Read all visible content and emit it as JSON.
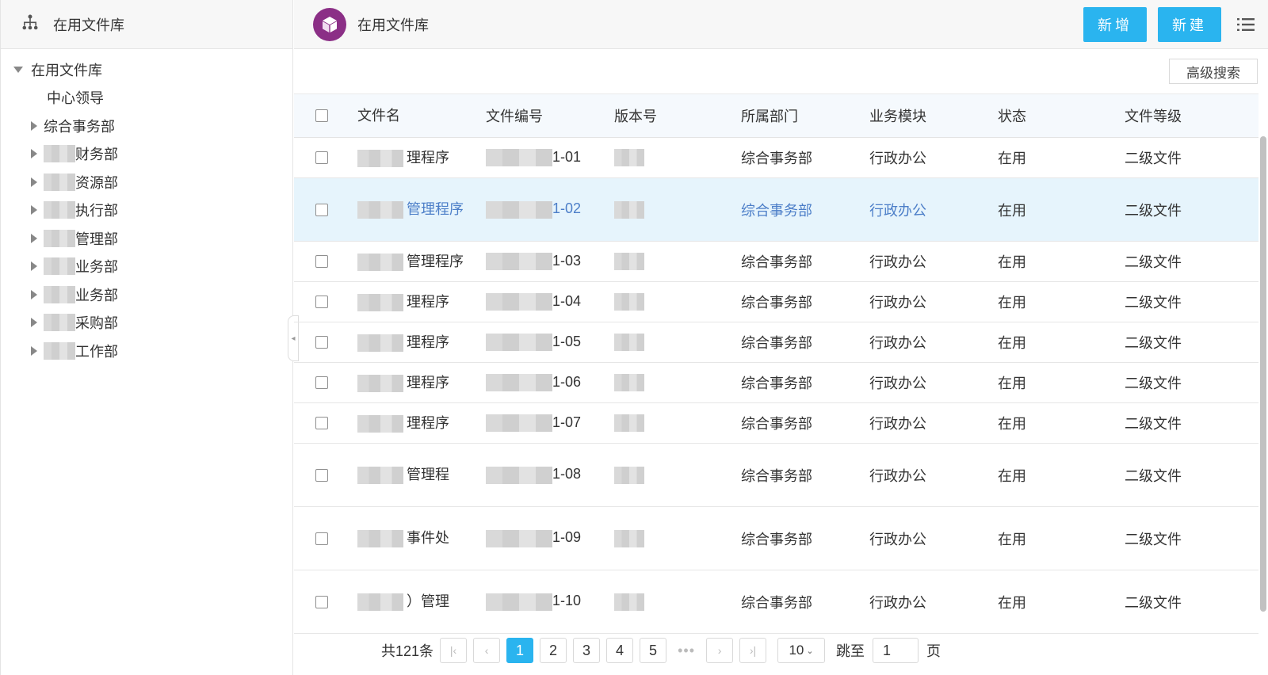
{
  "sidebar": {
    "title": "在用文件库",
    "tree_root": "在用文件库",
    "items": [
      {
        "label": "中心领导",
        "expandable": false,
        "blur_w": 0
      },
      {
        "label": "综合事务部",
        "expandable": true,
        "blur_w": 0
      },
      {
        "label": "财务部",
        "expandable": true,
        "blur_w": 40
      },
      {
        "label": "资源部",
        "expandable": true,
        "blur_w": 40
      },
      {
        "label": "执行部",
        "expandable": true,
        "blur_w": 40
      },
      {
        "label": "管理部",
        "expandable": true,
        "blur_w": 40
      },
      {
        "label": "业务部",
        "expandable": true,
        "blur_w": 40
      },
      {
        "label": "业务部",
        "expandable": true,
        "blur_w": 40
      },
      {
        "label": "采购部",
        "expandable": true,
        "blur_w": 40
      },
      {
        "label": "工作部",
        "expandable": true,
        "blur_w": 40
      }
    ]
  },
  "header": {
    "title": "在用文件库",
    "add_label": "新增",
    "new_label": "新建",
    "advanced_search_label": "高级搜索"
  },
  "table": {
    "columns": [
      "文件名",
      "文件编号",
      "版本号",
      "所属部门",
      "业务模块",
      "状态",
      "文件等级"
    ],
    "rows": [
      {
        "name": "理程序",
        "code": "1-01",
        "dept": "综合事务部",
        "module": "行政办公",
        "status": "在用",
        "level": "二级文件",
        "selected": false,
        "tall": false
      },
      {
        "name": "管理程序",
        "code": "1-02",
        "dept": "综合事务部",
        "module": "行政办公",
        "status": "在用",
        "level": "二级文件",
        "selected": true,
        "tall": true
      },
      {
        "name": "管理程序",
        "code": "1-03",
        "dept": "综合事务部",
        "module": "行政办公",
        "status": "在用",
        "level": "二级文件",
        "selected": false,
        "tall": false
      },
      {
        "name": "理程序",
        "code": "1-04",
        "dept": "综合事务部",
        "module": "行政办公",
        "status": "在用",
        "level": "二级文件",
        "selected": false,
        "tall": false
      },
      {
        "name": "理程序",
        "code": "1-05",
        "dept": "综合事务部",
        "module": "行政办公",
        "status": "在用",
        "level": "二级文件",
        "selected": false,
        "tall": false
      },
      {
        "name": "理程序",
        "code": "1-06",
        "dept": "综合事务部",
        "module": "行政办公",
        "status": "在用",
        "level": "二级文件",
        "selected": false,
        "tall": false
      },
      {
        "name": "理程序",
        "code": "1-07",
        "dept": "综合事务部",
        "module": "行政办公",
        "status": "在用",
        "level": "二级文件",
        "selected": false,
        "tall": false
      },
      {
        "name": "管理程",
        "code": "1-08",
        "dept": "综合事务部",
        "module": "行政办公",
        "status": "在用",
        "level": "二级文件",
        "selected": false,
        "tall": true
      },
      {
        "name": "事件处",
        "code": "1-09",
        "dept": "综合事务部",
        "module": "行政办公",
        "status": "在用",
        "level": "二级文件",
        "selected": false,
        "tall": true
      },
      {
        "name": "）管理",
        "code": "1-10",
        "dept": "综合事务部",
        "module": "行政办公",
        "status": "在用",
        "level": "二级文件",
        "selected": false,
        "tall": true
      }
    ]
  },
  "pagination": {
    "total_label": "共121条",
    "pages": [
      "1",
      "2",
      "3",
      "4",
      "5"
    ],
    "ellipsis": "•••",
    "current_page": "1",
    "page_size": "10",
    "jump_label": "跳至",
    "jump_value": "1",
    "page_suffix": "页"
  },
  "colors": {
    "accent": "#2ab4ef",
    "selected_row_bg": "#e6f4fc",
    "selected_text": "#4c7ec8",
    "logo": "#8b2f86"
  },
  "icons": {
    "sidebar_header": "org-tree-icon",
    "header_logo": "cube-icon",
    "menu": "list-menu-icon"
  }
}
